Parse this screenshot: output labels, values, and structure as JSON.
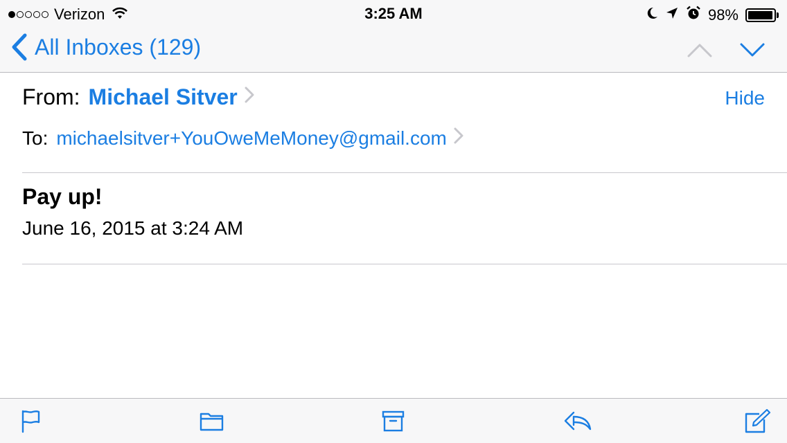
{
  "status_bar": {
    "carrier": "Verizon",
    "signal_strength": "1 of 5",
    "time": "3:25 AM",
    "battery_percent": "98%",
    "battery_level": 0.98,
    "icons": [
      "signal-dots-icon",
      "wifi-icon",
      "moon-icon",
      "location-arrow-icon",
      "alarm-icon",
      "battery-icon"
    ]
  },
  "nav_bar": {
    "back_label": "All Inboxes (129)",
    "back_icon": "chevron-left-icon",
    "prev_icon": "chevron-up-icon",
    "next_icon": "chevron-down-icon"
  },
  "message": {
    "from_label": "From:",
    "from_name": "Michael Sitver",
    "hide_label": "Hide",
    "to_label": "To:",
    "to_address": "michaelsitver+YouOweMeMoney@gmail.com",
    "subject": "Pay up!",
    "date": "June 16, 2015 at 3:24 AM"
  },
  "toolbar": {
    "icons": [
      "flag-icon",
      "folder-icon",
      "archive-icon",
      "reply-icon",
      "compose-icon"
    ]
  },
  "colors": {
    "accent": "#1b7ee2",
    "bar_background": "#f7f7f8",
    "separator": "#c8c7cc",
    "disabled_arrow": "#c7c7cc"
  }
}
